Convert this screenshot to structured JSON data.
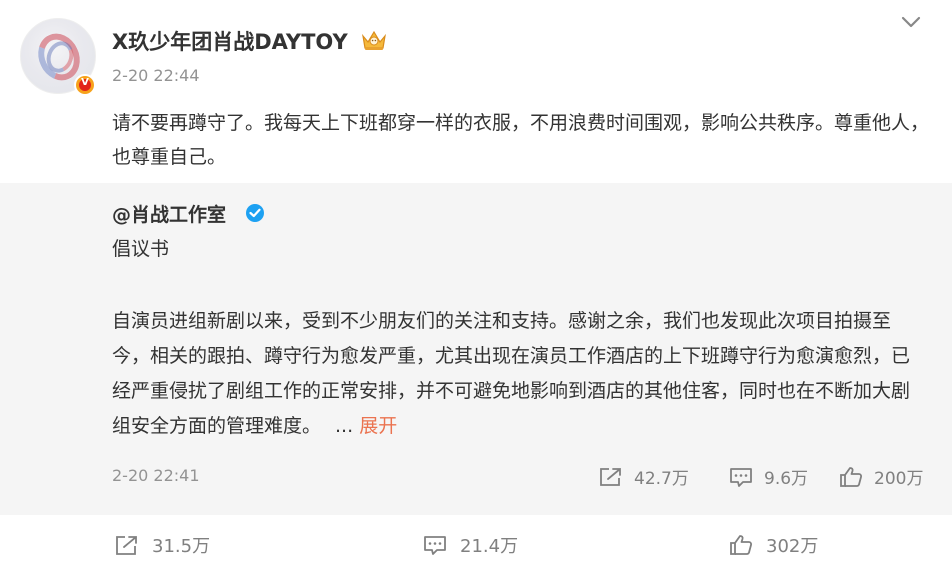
{
  "post": {
    "author": "X玖少年团肖战DAYTOY",
    "time": "2-20 22:44",
    "content": "请不要再蹲守了。我每天上下班都穿一样的衣服，不用浪费时间围观，影响公共秩序。尊重他人，也尊重自己。",
    "verified_badge": "V"
  },
  "repost": {
    "author": "@肖战工作室",
    "title": "倡议书",
    "body": "自演员进组新剧以来，受到不少朋友们的关注和支持。感谢之余，我们也发现此次项目拍摄至今，相关的跟拍、蹲守行为愈发严重，尤其出现在演员工作酒店的上下班蹲守行为愈演愈烈，已经严重侵扰了剧组工作的正常安排，并不可避免地影响到酒店的其他住客，同时也在不断加大剧组安全方面的管理难度。",
    "ellipsis": "...",
    "expand_label": "展开",
    "time": "2-20 22:41",
    "reposts": "42.7万",
    "comments": "9.6万",
    "likes": "200万"
  },
  "footer": {
    "reposts": "31.5万",
    "comments": "21.4万",
    "likes": "302万"
  },
  "icons": {
    "crown": "crown-icon",
    "verified_blue": "blue-v-icon",
    "menu": "chevron-down-icon",
    "repost": "repost-icon",
    "comment": "comment-icon",
    "like": "thumbs-up-icon"
  },
  "colors": {
    "link": "#eb7350",
    "muted": "#939393",
    "repost_bg": "#f5f5f5",
    "verified_blue": "#1da1f2"
  }
}
